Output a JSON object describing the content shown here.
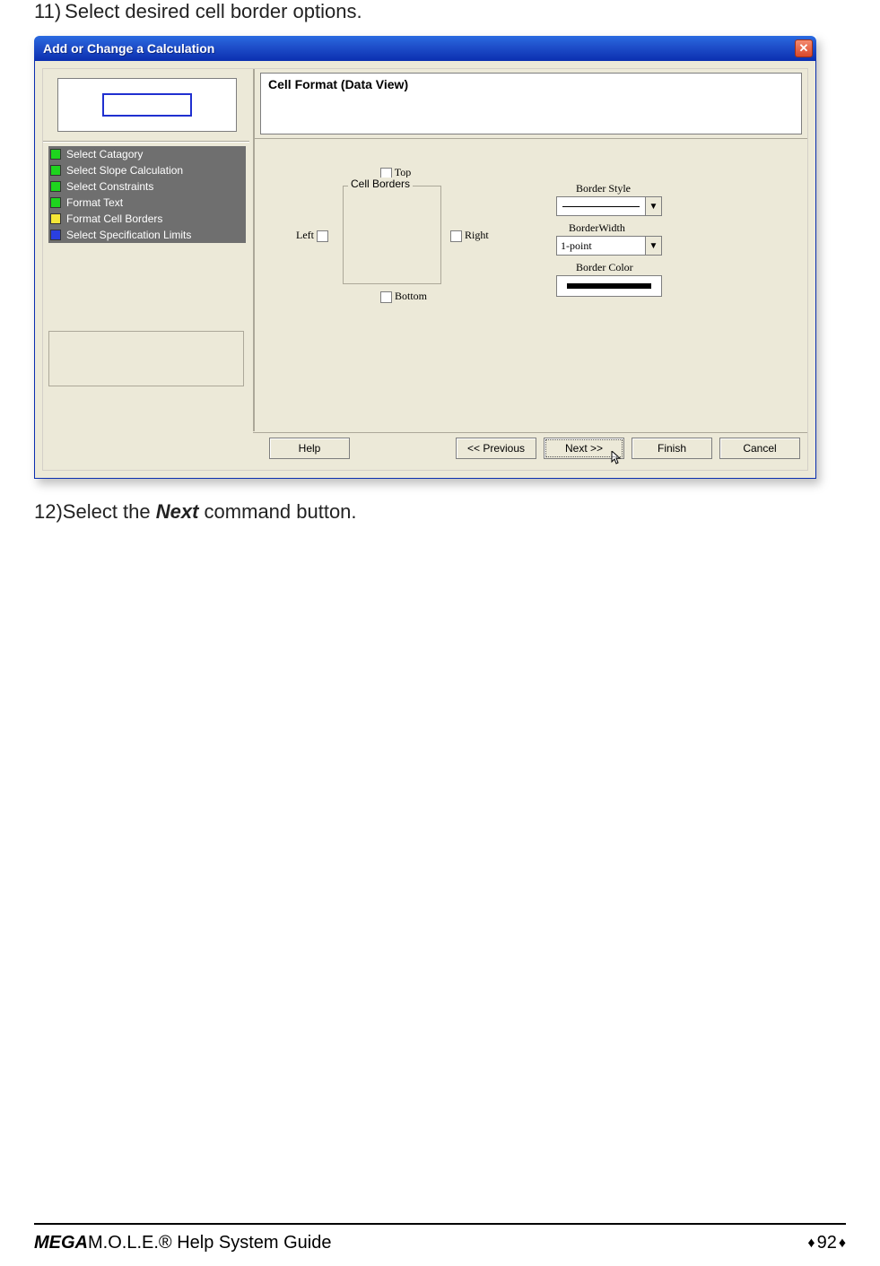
{
  "instruction_11": {
    "num": "11)",
    "text": "Select desired cell border options."
  },
  "instruction_12": {
    "num": "12)",
    "prefix": "Select the ",
    "bold": "Next",
    "suffix": " command button."
  },
  "dialog": {
    "title": "Add or Change a Calculation",
    "close_glyph": "✕",
    "steps": [
      {
        "color": "green",
        "label": "Select Catagory"
      },
      {
        "color": "green",
        "label": "Select Slope Calculation"
      },
      {
        "color": "green",
        "label": "Select Constraints"
      },
      {
        "color": "green",
        "label": "Format Text"
      },
      {
        "color": "yellow",
        "label": "Format Cell Borders"
      },
      {
        "color": "blue",
        "label": "Select Specification Limits"
      }
    ],
    "header": "Cell Format (Data View)",
    "group_label": "Cell Borders",
    "cb": {
      "top": "Top",
      "left": "Left",
      "right": "Right",
      "bottom": "Bottom"
    },
    "border_style_label": "Border Style",
    "border_width_label": "BorderWidth",
    "border_width_value": "1-point",
    "border_color_label": "Border Color",
    "buttons": {
      "help": "Help",
      "prev": "<< Previous",
      "next": "Next >>",
      "finish": "Finish",
      "cancel": "Cancel"
    }
  },
  "footer": {
    "bold1": "MEGA",
    "plain": "M.O.L.E.® Help System Guide",
    "page": "92",
    "diamond": "♦"
  }
}
